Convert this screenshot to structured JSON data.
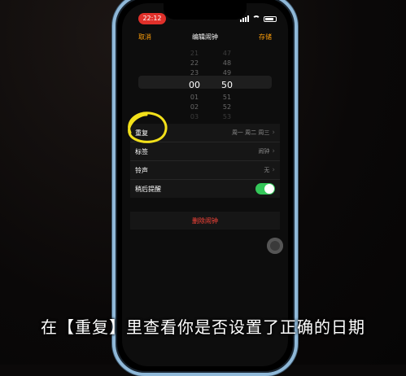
{
  "status_bar": {
    "time": "22:12",
    "icons": [
      "signal-icon",
      "wifi-icon",
      "battery-icon"
    ]
  },
  "nav": {
    "cancel": "取消",
    "title": "编辑闹钟",
    "save": "存储"
  },
  "picker": {
    "hours": [
      "21",
      "22",
      "23",
      "00",
      "01",
      "02"
    ],
    "minutes": [
      "47",
      "48",
      "49",
      "50",
      "51",
      "52"
    ],
    "selected_hour": "00",
    "selected_minute": "50",
    "extra_hour": "03",
    "extra_minute": "53"
  },
  "settings": {
    "repeat_label": "重复",
    "repeat_value": "周一 周二 周三",
    "label_label": "标签",
    "label_value": "闹钟",
    "sound_label": "铃声",
    "sound_value": "无",
    "snooze_label": "稍后提醒",
    "snooze_on": true
  },
  "delete_label": "删除闹钟",
  "caption": "在【重复】里查看你是否设置了正确的日期",
  "colors": {
    "accent": "#ff9f0a",
    "toggle": "#34c759",
    "danger": "#ff453a",
    "annotation": "#f2e01a",
    "frame": "#8fb8d8"
  }
}
